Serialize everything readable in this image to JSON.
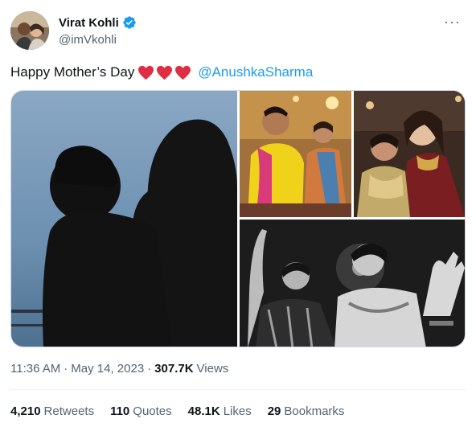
{
  "author": {
    "display_name": "Virat Kohli",
    "handle": "@imVkohli"
  },
  "icons": {
    "verified": "verified-badge-icon",
    "more": "more-options-icon",
    "heart": "red-heart-emoji"
  },
  "colors": {
    "accent": "#1d9bf0",
    "heart": "#e0245e",
    "secondary_text": "#536471"
  },
  "tweet": {
    "text": "Happy Mother’s Day",
    "mention": "@AnushkaSharma"
  },
  "meta": {
    "time": "11:36 AM",
    "separator1": "·",
    "date": "May 14, 2023",
    "separator2": "·",
    "views_count": "307.7K",
    "views_label": "Views"
  },
  "stats": [
    {
      "count": "4,210",
      "label": "Retweets"
    },
    {
      "count": "110",
      "label": "Quotes"
    },
    {
      "count": "48.1K",
      "label": "Likes"
    },
    {
      "count": "29",
      "label": "Bookmarks"
    }
  ]
}
